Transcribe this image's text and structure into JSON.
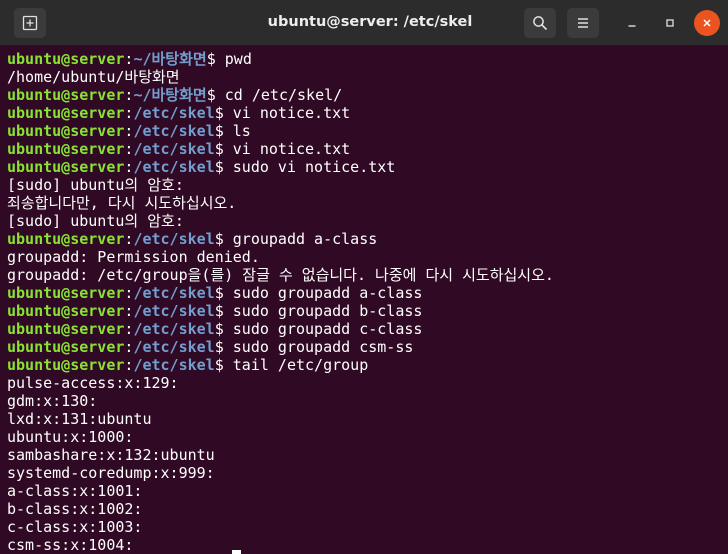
{
  "window": {
    "title": "ubuntu@server: /etc/skel"
  },
  "icons": {
    "new_tab": "new-tab-icon",
    "search": "search-icon",
    "menu": "hamburger-menu-icon",
    "minimize": "minimize-icon",
    "maximize": "maximize-icon",
    "close": "close-icon"
  },
  "colors": {
    "terminal_bg": "#300a24",
    "user_host": "#8ae234",
    "path": "#729fcf",
    "titlebar": "#2c2c2c",
    "close_button": "#e95420"
  },
  "terminal": {
    "lines": [
      {
        "user": "ubuntu@server",
        "sep": ":",
        "path": "~/바탕화면",
        "cmd": "$ pwd"
      },
      {
        "text": "/home/ubuntu/바탕화면"
      },
      {
        "user": "ubuntu@server",
        "sep": ":",
        "path": "~/바탕화면",
        "cmd": "$ cd /etc/skel/"
      },
      {
        "user": "ubuntu@server",
        "sep": ":",
        "path": "/etc/skel",
        "cmd": "$ vi notice.txt"
      },
      {
        "user": "ubuntu@server",
        "sep": ":",
        "path": "/etc/skel",
        "cmd": "$ ls"
      },
      {
        "user": "ubuntu@server",
        "sep": ":",
        "path": "/etc/skel",
        "cmd": "$ vi notice.txt"
      },
      {
        "user": "ubuntu@server",
        "sep": ":",
        "path": "/etc/skel",
        "cmd": "$ sudo vi notice.txt"
      },
      {
        "text": "[sudo] ubuntu의 암호:"
      },
      {
        "text": "죄송합니다만, 다시 시도하십시오."
      },
      {
        "text": "[sudo] ubuntu의 암호:"
      },
      {
        "user": "ubuntu@server",
        "sep": ":",
        "path": "/etc/skel",
        "cmd": "$ groupadd a-class"
      },
      {
        "text": "groupadd: Permission denied."
      },
      {
        "text": "groupadd: /etc/group을(를) 잠글 수 없습니다. 나중에 다시 시도하십시오."
      },
      {
        "user": "ubuntu@server",
        "sep": ":",
        "path": "/etc/skel",
        "cmd": "$ sudo groupadd a-class"
      },
      {
        "user": "ubuntu@server",
        "sep": ":",
        "path": "/etc/skel",
        "cmd": "$ sudo groupadd b-class"
      },
      {
        "user": "ubuntu@server",
        "sep": ":",
        "path": "/etc/skel",
        "cmd": "$ sudo groupadd c-class"
      },
      {
        "user": "ubuntu@server",
        "sep": ":",
        "path": "/etc/skel",
        "cmd": "$ sudo groupadd csm-ss"
      },
      {
        "user": "ubuntu@server",
        "sep": ":",
        "path": "/etc/skel",
        "cmd": "$ tail /etc/group"
      },
      {
        "text": "pulse-access:x:129:"
      },
      {
        "text": "gdm:x:130:"
      },
      {
        "text": "lxd:x:131:ubuntu"
      },
      {
        "text": "ubuntu:x:1000:"
      },
      {
        "text": "sambashare:x:132:ubuntu"
      },
      {
        "text": "systemd-coredump:x:999:"
      },
      {
        "text": "a-class:x:1001:"
      },
      {
        "text": "b-class:x:1002:"
      },
      {
        "text": "c-class:x:1003:"
      },
      {
        "text": "csm-ss:x:1004:"
      }
    ]
  }
}
